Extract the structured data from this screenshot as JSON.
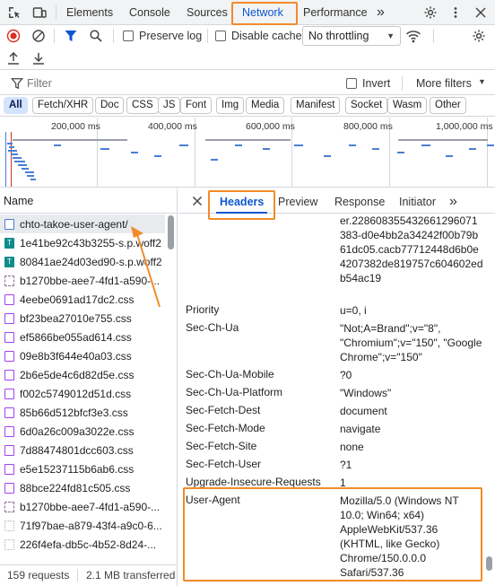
{
  "tabs": [
    "Elements",
    "Console",
    "Sources",
    "Network",
    "Performance"
  ],
  "more_tabs": "»",
  "toolbar": {
    "preserve_log": "Preserve log",
    "disable_cache": "Disable cache",
    "throttling": "No throttling"
  },
  "filter": {
    "placeholder": "Filter",
    "invert": "Invert",
    "more_filters": "More filters"
  },
  "types": [
    "All",
    "Fetch/XHR",
    "Doc",
    "CSS",
    "JS",
    "Font",
    "Img",
    "Media",
    "Manifest",
    "Socket",
    "Wasm",
    "Other"
  ],
  "timeline": {
    "ticks": [
      "200,000 ms",
      "400,000 ms",
      "600,000 ms",
      "800,000 ms",
      "1,000,000 ms"
    ]
  },
  "requests": {
    "header": "Name",
    "items": [
      {
        "name": "chto-takoe-user-agent/",
        "type": "doc"
      },
      {
        "name": "1e41be92c43b3255-s.p.woff2",
        "type": "font"
      },
      {
        "name": "80841ae24d03ed90-s.p.woff2",
        "type": "font"
      },
      {
        "name": "b1270bbe-aee7-4fd1-a590-...",
        "type": "other"
      },
      {
        "name": "4eebe0691ad17dc2.css",
        "type": "css"
      },
      {
        "name": "bf23bea27010e755.css",
        "type": "css"
      },
      {
        "name": "ef5866be055ad614.css",
        "type": "css"
      },
      {
        "name": "09e8b3f644e40a03.css",
        "type": "css"
      },
      {
        "name": "2b6e5de4c6d82d5e.css",
        "type": "css"
      },
      {
        "name": "f002c5749012d51d.css",
        "type": "css"
      },
      {
        "name": "85b66d512bfcf3e3.css",
        "type": "css"
      },
      {
        "name": "6d0a26c009a3022e.css",
        "type": "css"
      },
      {
        "name": "7d88474801dcc603.css",
        "type": "css"
      },
      {
        "name": "e5e15237115b6ab6.css",
        "type": "css"
      },
      {
        "name": "88bce224fd81c505.css",
        "type": "css"
      },
      {
        "name": "b1270bbe-aee7-4fd1-a590-...",
        "type": "other"
      },
      {
        "name": "71f97bae-a879-43f4-a9c0-6...",
        "type": "img"
      },
      {
        "name": "226f4efa-db5c-4b52-8d24-...",
        "type": "img"
      }
    ],
    "status_count": "159 requests",
    "status_transferred": "2.1 MB transferred"
  },
  "details": {
    "tabs": [
      "Headers",
      "Preview",
      "Response",
      "Initiator"
    ],
    "more_tabs": "»",
    "top_value": "er.228608355432661296071383-d0e4bb2a34242f00b79b61dc05.cacb77712448d6b0e4207382de819757c604602edb54ac19",
    "headers": [
      {
        "key": "Priority",
        "value": "u=0, i"
      },
      {
        "key": "Sec-Ch-Ua",
        "value": "\"Not;A=Brand\";v=\"8\", \"Chromium\";v=\"150\", \"Google Chrome\";v=\"150\""
      },
      {
        "key": "Sec-Ch-Ua-Mobile",
        "value": "?0"
      },
      {
        "key": "Sec-Ch-Ua-Platform",
        "value": "\"Windows\""
      },
      {
        "key": "Sec-Fetch-Dest",
        "value": "document"
      },
      {
        "key": "Sec-Fetch-Mode",
        "value": "navigate"
      },
      {
        "key": "Sec-Fetch-Site",
        "value": "none"
      },
      {
        "key": "Sec-Fetch-User",
        "value": "?1"
      },
      {
        "key": "Upgrade-Insecure-Requests",
        "value": "1"
      },
      {
        "key": "User-Agent",
        "value": "Mozilla/5.0 (Windows NT 10.0; Win64; x64) AppleWebKit/537.36 (KHTML, like Gecko) Chrome/150.0.0.0 Safari/537.36"
      }
    ]
  },
  "colors": {
    "accent": "#0b57d0",
    "highlight": "#f28b2a",
    "record_red": "#d93025"
  }
}
